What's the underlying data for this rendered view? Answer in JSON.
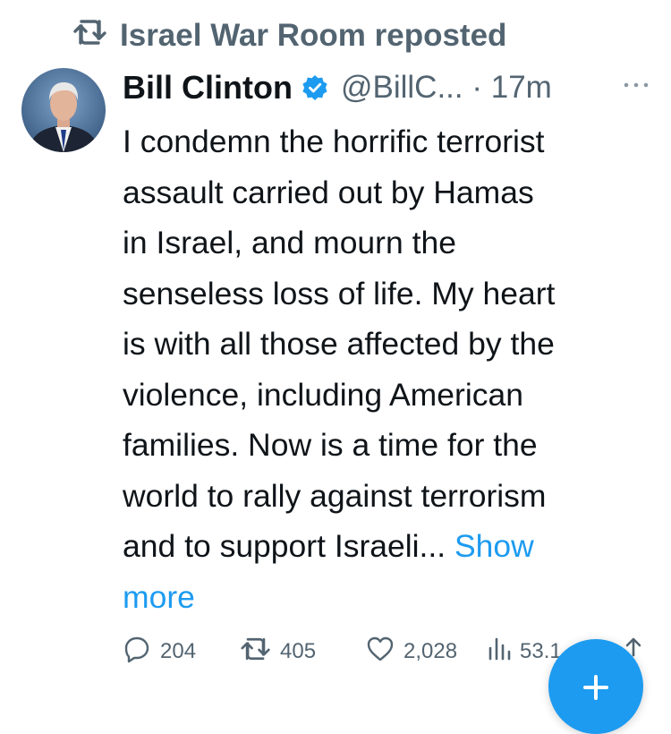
{
  "repost_line": {
    "text": "Israel War Room reposted",
    "icon": "repost-icon"
  },
  "tweet": {
    "author_name": "Bill Clinton",
    "verified_icon": "verified-badge-icon",
    "handle_time": "@BillC... · 17m",
    "more_icon": "more-dots-icon",
    "body": "I condemn the horrific terrorist\nassault carried out by Hamas\nin Israel, and mourn the\nsenseless loss of life. My heart\nis with all those affected by the\nviolence, including American\nfamilies. Now is a time for the\nworld to rally against terrorism\nand to support Israeli... ",
    "show_more": "Show\nmore"
  },
  "actions": {
    "replies": "204",
    "reposts": "405",
    "likes": "2,028",
    "views": "53.1"
  },
  "colors": {
    "accent": "#1d9bf0",
    "muted": "#536471",
    "text": "#0f1419"
  }
}
